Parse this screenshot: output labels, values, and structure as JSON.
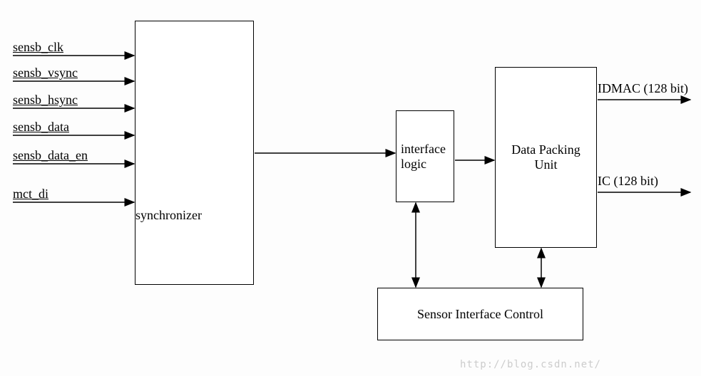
{
  "inputs": {
    "s0": "sensb_clk",
    "s1": "sensb_vsync",
    "s2": "sensb_hsync",
    "s3": "sensb_data",
    "s4": "sensb_data_en",
    "s5": "mct_di"
  },
  "blocks": {
    "synchronizer": "synchronizer",
    "interface_logic": "interface\nlogic",
    "data_packing_unit": "Data Packing\nUnit",
    "sensor_interface_control": "Sensor Interface Control"
  },
  "outputs": {
    "idmac": "IDMAC (128 bit)",
    "ic": "IC (128 bit)"
  },
  "watermark": "http://blog.csdn.net/"
}
